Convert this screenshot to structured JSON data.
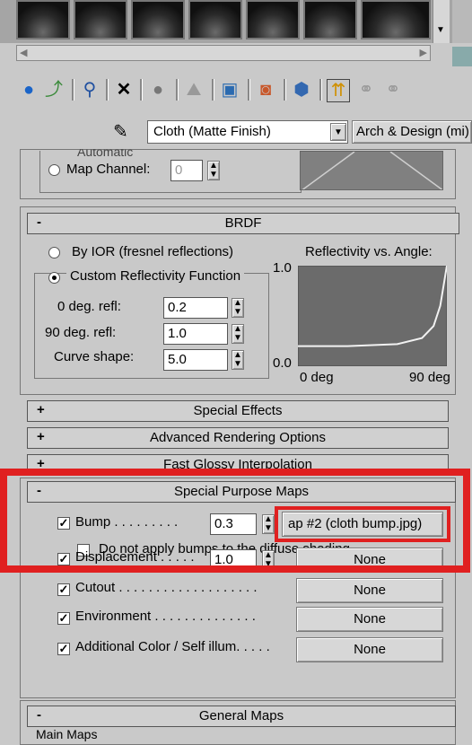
{
  "toolbar": {
    "material_name": "Cloth (Matte Finish)",
    "material_type": "Arch & Design (mi)"
  },
  "top_rollout": {
    "automatic_label": "Automatic",
    "map_channel_label": "Map Channel:",
    "map_channel_value": "0"
  },
  "brdf": {
    "header": "BRDF",
    "by_ior_label": "By IOR (fresnel reflections)",
    "custom_label": "Custom Reflectivity Function",
    "chart_title": "Reflectivity vs. Angle:",
    "y_max": "1.0",
    "y_min": "0.0",
    "x_min": "0 deg",
    "x_max": "90 deg",
    "fields": [
      {
        "label": "0 deg. refl:",
        "value": "0.2"
      },
      {
        "label": "90 deg. refl:",
        "value": "1.0"
      },
      {
        "label": "Curve shape:",
        "value": "5.0"
      }
    ]
  },
  "collapsed_rollouts": [
    {
      "sign": "+",
      "label": "Special Effects"
    },
    {
      "sign": "+",
      "label": "Advanced Rendering Options"
    },
    {
      "sign": "+",
      "label": "Fast Glossy Interpolation"
    }
  ],
  "special_maps": {
    "sign": "-",
    "header": "Special Purpose Maps",
    "bump_label": "Bump . . . . . . . . .",
    "bump_value": "0.3",
    "bump_map": "ap #2 (cloth bump.jpg)",
    "no_bump_diffuse": "Do not apply bumps to the diffuse shading",
    "rows": [
      {
        "label": "Displacement . . . . .",
        "value": "1.0",
        "map": "None"
      },
      {
        "label": "Cutout . . . . . . . . . . . . . . . . . . .",
        "map": "None"
      },
      {
        "label": "Environment . . . . . . . . . . . . . .",
        "map": "None"
      },
      {
        "label": "Additional Color / Self illum. . . . .",
        "map": "None"
      }
    ]
  },
  "general_maps": {
    "sign": "-",
    "header": "General Maps",
    "main_maps": "Main Maps"
  },
  "chart_data": {
    "type": "line",
    "title": "Reflectivity vs. Angle:",
    "x": [
      0,
      15,
      30,
      45,
      60,
      75,
      82,
      86,
      90
    ],
    "y": [
      0.2,
      0.2,
      0.2,
      0.21,
      0.22,
      0.28,
      0.4,
      0.6,
      1.0
    ],
    "xlim": [
      0,
      90
    ],
    "ylim": [
      0.0,
      1.0
    ]
  }
}
